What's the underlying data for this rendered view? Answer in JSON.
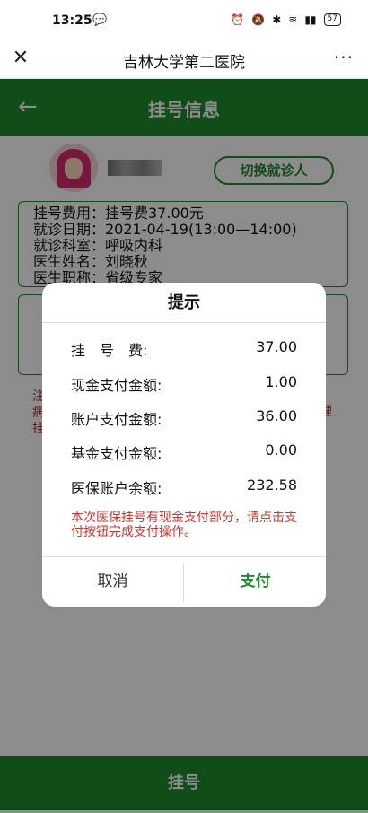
{
  "status_bar": {
    "time": "13:25",
    "battery": "57"
  },
  "browser": {
    "title": "吉林大学第二医院",
    "more": "···"
  },
  "header": {
    "title": "挂号信息"
  },
  "patient": {
    "switch_label": "切换就诊人"
  },
  "info": {
    "fee": "挂号费用：挂号费37.00元",
    "date": "就诊日期：2021-04-19(13:00—14:00)",
    "dept": "就诊科室：呼吸内科",
    "doctor": "医生姓名：刘晓秋",
    "title": "医生职称：省级专家"
  },
  "note_partial": "注\n病\n挂",
  "note_partial_right": "理",
  "bottom_button": "挂号",
  "dialog": {
    "title": "提示",
    "rows": [
      {
        "label": "挂　号　费:",
        "value": "37.00"
      },
      {
        "label": "现金支付金额:",
        "value": "1.00"
      },
      {
        "label": "账户支付金额:",
        "value": "36.00"
      },
      {
        "label": "基金支付金额:",
        "value": "0.00"
      },
      {
        "label": "医保账户余额:",
        "value": "232.58"
      }
    ],
    "message": "本次医保挂号有现金支付部分，请点击支付按钮完成支付操作。",
    "cancel_label": "取消",
    "pay_label": "支付"
  },
  "colors": {
    "brand_green": "#1e8c2c",
    "warning_red": "#d0342c"
  }
}
